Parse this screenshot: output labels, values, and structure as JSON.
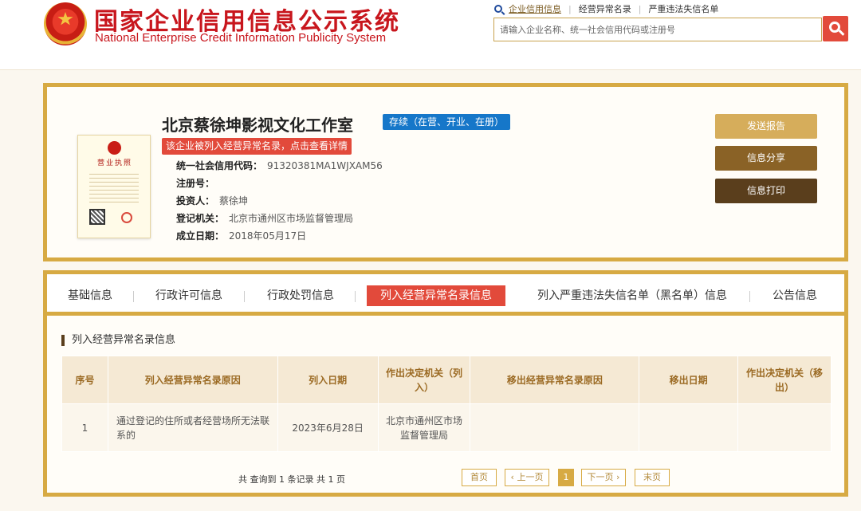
{
  "header": {
    "title_cn": "国家企业信用信息公示系统",
    "title_en": "National Enterprise Credit Information Publicity System",
    "top_links": [
      "企业信用信息",
      "经营异常名录",
      "严重违法失信名单"
    ],
    "search": {
      "placeholder": "请输入企业名称、统一社会信用代码或注册号"
    }
  },
  "company": {
    "name": "北京蔡徐坤影视文化工作室",
    "status": "存续（在营、开业、在册）",
    "warning": "该企业被列入经营异常名录，点击查看详情",
    "license_title": "营业执照",
    "fields": [
      {
        "key": "统一社会信用代码：",
        "value": "91320381MA1WJXAM56"
      },
      {
        "key": "注册号：",
        "value": ""
      },
      {
        "key": "投资人：",
        "value": "蔡徐坤"
      },
      {
        "key": "登记机关：",
        "value": "北京市通州区市场监督管理局"
      },
      {
        "key": "成立日期：",
        "value": "2018年05月17日"
      }
    ],
    "buttons": {
      "report": "发送报告",
      "share": "信息分享",
      "print": "信息打印"
    }
  },
  "tabs": [
    "基础信息",
    "行政许可信息",
    "行政处罚信息",
    "列入经营异常名录信息",
    "列入严重违法失信名单（黑名单）信息",
    "公告信息"
  ],
  "active_tab_index": 3,
  "section": {
    "title": "列入经营异常名录信息",
    "columns": [
      "序号",
      "列入经营异常名录原因",
      "列入日期",
      "作出决定机关（列入）",
      "移出经营异常名录原因",
      "移出日期",
      "作出决定机关（移出）"
    ],
    "rows": [
      [
        "1",
        "通过登记的住所或者经营场所无法联系的",
        "2023年6月28日",
        "北京市通州区市场监督管理局",
        "",
        "",
        ""
      ]
    ]
  },
  "pagination": {
    "total_text": "共 查询到 1 条记录 共 1 页",
    "first": "首页",
    "prev": "‹ 上一页",
    "current": "1",
    "next": "下一页 ›",
    "last": "末页"
  },
  "colors": {
    "brand_red": "#c8161d",
    "gold_border": "#d7aa43",
    "active_tab": "#e24a3b",
    "status_blue": "#1677c9"
  }
}
